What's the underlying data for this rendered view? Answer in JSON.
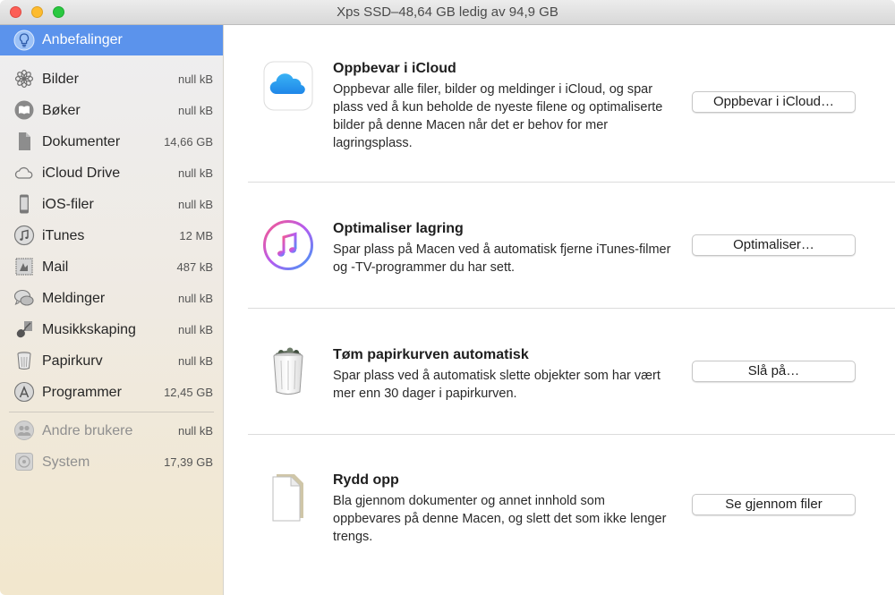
{
  "window": {
    "title": "Xps SSD–48,64 GB ledig av 94,9 GB"
  },
  "sidebar": {
    "selected": {
      "label": "Anbefalinger",
      "icon": "lightbulb-icon"
    },
    "items": [
      {
        "label": "Bilder",
        "size": "null kB",
        "icon": "photos-icon"
      },
      {
        "label": "Bøker",
        "size": "null kB",
        "icon": "books-icon"
      },
      {
        "label": "Dokumenter",
        "size": "14,66 GB",
        "icon": "document-icon"
      },
      {
        "label": "iCloud Drive",
        "size": "null kB",
        "icon": "cloud-icon"
      },
      {
        "label": "iOS-filer",
        "size": "null kB",
        "icon": "iphone-icon"
      },
      {
        "label": "iTunes",
        "size": "12 MB",
        "icon": "music-note-icon"
      },
      {
        "label": "Mail",
        "size": "487 kB",
        "icon": "mail-stamp-icon"
      },
      {
        "label": "Meldinger",
        "size": "null kB",
        "icon": "chat-bubbles-icon"
      },
      {
        "label": "Musikkskaping",
        "size": "null kB",
        "icon": "guitar-icon"
      },
      {
        "label": "Papirkurv",
        "size": "null kB",
        "icon": "trash-icon"
      },
      {
        "label": "Programmer",
        "size": "12,45 GB",
        "icon": "app-store-icon"
      }
    ],
    "others": [
      {
        "label": "Andre brukere",
        "size": "null kB",
        "icon": "users-icon"
      },
      {
        "label": "System",
        "size": "17,39 GB",
        "icon": "system-disk-icon"
      }
    ]
  },
  "recommendations": [
    {
      "title": "Oppbevar i iCloud",
      "description": "Oppbevar alle filer, bilder og meldinger i iCloud, og spar plass ved å kun beholde de nyeste filene og optimaliserte bilder på denne Macen når det er behov for mer lagringsplass.",
      "button": "Oppbevar i iCloud…",
      "icon": "icloud-icon"
    },
    {
      "title": "Optimaliser lagring",
      "description": "Spar plass på Macen ved å automatisk fjerne iTunes-filmer og -TV-programmer du har sett.",
      "button": "Optimaliser…",
      "icon": "itunes-icon"
    },
    {
      "title": "Tøm papirkurven automatisk",
      "description": "Spar plass ved å automatisk slette objekter som har vært mer enn 30 dager i papirkurven.",
      "button": "Slå på…",
      "icon": "full-trash-icon"
    },
    {
      "title": "Rydd opp",
      "description": "Bla gjennom dokumenter og annet innhold som oppbevares på denne Macen, og slett det som ikke lenger trengs.",
      "button": "Se gjennom filer",
      "icon": "document-stack-icon"
    }
  ],
  "colors": {
    "selection": "#5b93ec",
    "close": "#fc5f57",
    "minimize": "#fdbb2e",
    "maximize": "#2ac840"
  }
}
